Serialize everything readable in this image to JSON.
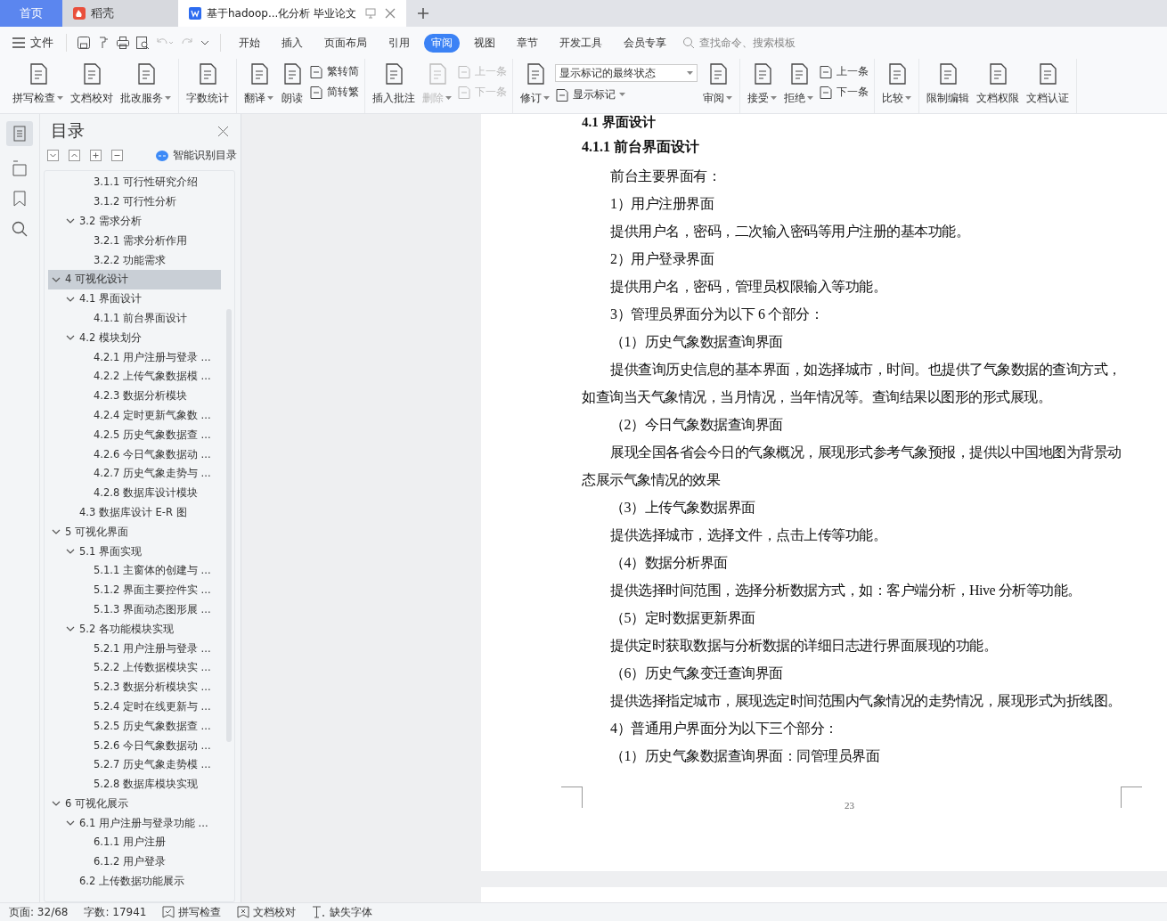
{
  "tabs": [
    {
      "kind": "home",
      "label": "首页",
      "selected": false
    },
    {
      "kind": "docer",
      "label": "稻壳",
      "selected": false
    },
    {
      "kind": "doc",
      "label": "基于hadoop...化分析 毕业论文",
      "selected": true
    }
  ],
  "menu": {
    "file": "文件",
    "search_placeholder": "查找命令、搜索模板"
  },
  "ribbon_tabs": [
    {
      "label": "开始",
      "selected": false
    },
    {
      "label": "插入",
      "selected": false
    },
    {
      "label": "页面布局",
      "selected": false
    },
    {
      "label": "引用",
      "selected": false
    },
    {
      "label": "审阅",
      "selected": true
    },
    {
      "label": "视图",
      "selected": false
    },
    {
      "label": "章节",
      "selected": false
    },
    {
      "label": "开发工具",
      "selected": false
    },
    {
      "label": "会员专享",
      "selected": false
    }
  ],
  "ribbon": [
    {
      "items": [
        {
          "kind": "large",
          "label": "拼写检查",
          "dropdown": true,
          "disabled": false
        },
        {
          "kind": "large",
          "label": "文档校对",
          "dropdown": false,
          "disabled": false
        },
        {
          "kind": "large",
          "label": "批改服务",
          "dropdown": true,
          "disabled": false
        }
      ]
    },
    {
      "items": [
        {
          "kind": "large",
          "label": "字数统计",
          "dropdown": false,
          "disabled": false
        }
      ]
    },
    {
      "items": [
        {
          "kind": "large",
          "label": "翻译",
          "dropdown": true,
          "disabled": false
        },
        {
          "kind": "large",
          "label": "朗读",
          "dropdown": false,
          "disabled": false
        },
        {
          "kind": "stack",
          "items": [
            {
              "label": "繁转简",
              "dropdown": false,
              "disabled": false
            },
            {
              "label": "简转繁",
              "dropdown": false,
              "disabled": false
            }
          ]
        }
      ]
    },
    {
      "items": [
        {
          "kind": "large",
          "label": "插入批注",
          "dropdown": false,
          "disabled": false
        },
        {
          "kind": "large",
          "label": "删除",
          "dropdown": true,
          "disabled": true
        },
        {
          "kind": "stack",
          "items": [
            {
              "label": "上一条",
              "dropdown": false,
              "disabled": true
            },
            {
              "label": "下一条",
              "dropdown": false,
              "disabled": true
            }
          ]
        }
      ]
    },
    {
      "items": [
        {
          "kind": "large",
          "label": "修订",
          "dropdown": true,
          "disabled": false
        },
        {
          "kind": "select",
          "value": "显示标记的最终状态",
          "sub": {
            "label": "显示标记",
            "dropdown": true,
            "disabled": false
          }
        },
        {
          "kind": "large",
          "label": "审阅",
          "dropdown": true,
          "disabled": false
        }
      ]
    },
    {
      "items": [
        {
          "kind": "large",
          "label": "接受",
          "dropdown": true,
          "disabled": false
        },
        {
          "kind": "large",
          "label": "拒绝",
          "dropdown": true,
          "disabled": false
        },
        {
          "kind": "stack",
          "items": [
            {
              "label": "上一条",
              "dropdown": false,
              "disabled": false
            },
            {
              "label": "下一条",
              "dropdown": false,
              "disabled": false
            }
          ]
        }
      ]
    },
    {
      "items": [
        {
          "kind": "large",
          "label": "比较",
          "dropdown": true,
          "disabled": false
        }
      ]
    },
    {
      "items": [
        {
          "kind": "large",
          "label": "限制编辑",
          "dropdown": false,
          "disabled": false
        },
        {
          "kind": "large",
          "label": "文档权限",
          "dropdown": false,
          "disabled": false
        },
        {
          "kind": "large",
          "label": "文档认证",
          "dropdown": false,
          "disabled": false
        }
      ]
    }
  ],
  "toc": {
    "title": "目录",
    "smart": "智能识别目录",
    "items": [
      {
        "children": [
          {
            "children": [
              {
                "label": "3.1.1 可行性研究介绍",
                "selected": false
              },
              {
                "label": "3.1.2 可行性分析",
                "selected": false
              }
            ]
          },
          {
            "label": "3.2 需求分析",
            "selected": false,
            "expanded": true,
            "children": [
              {
                "label": "3.2.1 需求分析作用",
                "selected": false
              },
              {
                "label": "3.2.2 功能需求",
                "selected": false
              }
            ]
          }
        ]
      },
      {
        "label": "4  可视化设计",
        "selected": true,
        "expanded": true,
        "children": [
          {
            "label": "4.1 界面设计",
            "selected": false,
            "expanded": true,
            "children": [
              {
                "label": "4.1.1 前台界面设计",
                "selected": false
              }
            ]
          },
          {
            "label": "4.2 模块划分",
            "selected": false,
            "expanded": true,
            "children": [
              {
                "label": "4.2.1 用户注册与登录 ...",
                "selected": false
              },
              {
                "label": "4.2.2 上传气象数据模 ...",
                "selected": false
              },
              {
                "label": "4.2.3 数据分析模块",
                "selected": false
              },
              {
                "label": "4.2.4 定时更新气象数 ...",
                "selected": false
              },
              {
                "label": "4.2.5 历史气象数据查 ...",
                "selected": false
              },
              {
                "label": "4.2.6 今日气象数据动 ...",
                "selected": false
              },
              {
                "label": "4.2.7 历史气象走势与 ...",
                "selected": false
              },
              {
                "label": "4.2.8 数据库设计模块",
                "selected": false
              }
            ]
          },
          {
            "label": "4.3 数据库设计 E-R 图",
            "selected": false
          }
        ]
      },
      {
        "label": "5  可视化界面",
        "selected": false,
        "expanded": true,
        "children": [
          {
            "label": "5.1 界面实现",
            "selected": false,
            "expanded": true,
            "children": [
              {
                "label": "5.1.1 主窗体的创建与 ...",
                "selected": false
              },
              {
                "label": "5.1.2  界面主要控件实 ...",
                "selected": false
              },
              {
                "label": "5.1.3 界面动态图形展 ...",
                "selected": false
              }
            ]
          },
          {
            "label": "5.2 各功能模块实现",
            "selected": false,
            "expanded": true,
            "children": [
              {
                "label": "5.2.1 用户注册与登录 ...",
                "selected": false
              },
              {
                "label": "5.2.2 上传数据模块实 ...",
                "selected": false
              },
              {
                "label": "5.2.3 数据分析模块实 ...",
                "selected": false
              },
              {
                "label": "5.2.4 定时在线更新与 ...",
                "selected": false
              },
              {
                "label": "5.2.5 历史气象数据查 ...",
                "selected": false
              },
              {
                "label": "5.2.6 今日气象数据动 ...",
                "selected": false
              },
              {
                "label": "5.2.7 历史气象走势模 ...",
                "selected": false
              },
              {
                "label": "5.2.8 数据库模块实现",
                "selected": false
              }
            ]
          }
        ]
      },
      {
        "label": "6  可视化展示",
        "selected": false,
        "expanded": true,
        "children": [
          {
            "label": "6.1 用户注册与登录功能 ...",
            "selected": false,
            "expanded": true,
            "children": [
              {
                "label": "6.1.1 用户注册",
                "selected": false
              },
              {
                "label": "6.1.2 用户登录",
                "selected": false
              }
            ]
          },
          {
            "label": "6.2 上传数据功能展示",
            "selected": false
          }
        ]
      }
    ]
  },
  "document": {
    "page_number": "23",
    "paragraphs": [
      {
        "kind": "heading",
        "text": "4.1 界面设计"
      },
      {
        "kind": "subheading",
        "text": "4.1.1 前台界面设计"
      },
      {
        "kind": "para",
        "text": "前台主要界面有："
      },
      {
        "kind": "para",
        "text": "1）用户注册界面"
      },
      {
        "kind": "para",
        "text": "提供用户名，密码，二次输入密码等用户注册的基本功能。"
      },
      {
        "kind": "para",
        "text": "2）用户登录界面"
      },
      {
        "kind": "para",
        "text": "提供用户名，密码，管理员权限输入等功能。"
      },
      {
        "kind": "para",
        "text": "3）管理员界面分为以下 6 个部分："
      },
      {
        "kind": "para",
        "text": "（1）历史气象数据查询界面"
      },
      {
        "kind": "para",
        "text": "提供查询历史信息的基本界面，如选择城市，时间。也提供了气象数据的查询方式，如查询当天气象情况，当月情况，当年情况等。查询结果以图形的形式展现。"
      },
      {
        "kind": "para",
        "text": "（2）今日气象数据查询界面"
      },
      {
        "kind": "para",
        "text": "展现全国各省会今日的气象概况，展现形式参考气象预报，提供以中国地图为背景动态展示气象情况的效果"
      },
      {
        "kind": "para",
        "text": "（3）上传气象数据界面"
      },
      {
        "kind": "para",
        "text": "提供选择城市，选择文件，点击上传等功能。"
      },
      {
        "kind": "para",
        "text": "（4）数据分析界面"
      },
      {
        "kind": "para",
        "text": "提供选择时间范围，选择分析数据方式，如：客户端分析，Hive 分析等功能。"
      },
      {
        "kind": "para",
        "text": "（5）定时数据更新界面"
      },
      {
        "kind": "para",
        "text": "提供定时获取数据与分析数据的详细日志进行界面展现的功能。"
      },
      {
        "kind": "para",
        "text": "（6）历史气象变迁查询界面"
      },
      {
        "kind": "para",
        "text": "提供选择指定城市，展现选定时间范围内气象情况的走势情况，展现形式为折线图。"
      },
      {
        "kind": "para",
        "text": "4）普通用户界面分为以下三个部分："
      },
      {
        "kind": "para",
        "text": "（1）历史气象数据查询界面：同管理员界面"
      }
    ]
  },
  "status_bar": {
    "page": "页面: 32/68",
    "words": "字数: 17941",
    "items": [
      {
        "kind": "spell",
        "label": "拼写检查"
      },
      {
        "kind": "proof",
        "label": "文档校对"
      },
      {
        "kind": "font",
        "label": "缺失字体"
      }
    ]
  }
}
